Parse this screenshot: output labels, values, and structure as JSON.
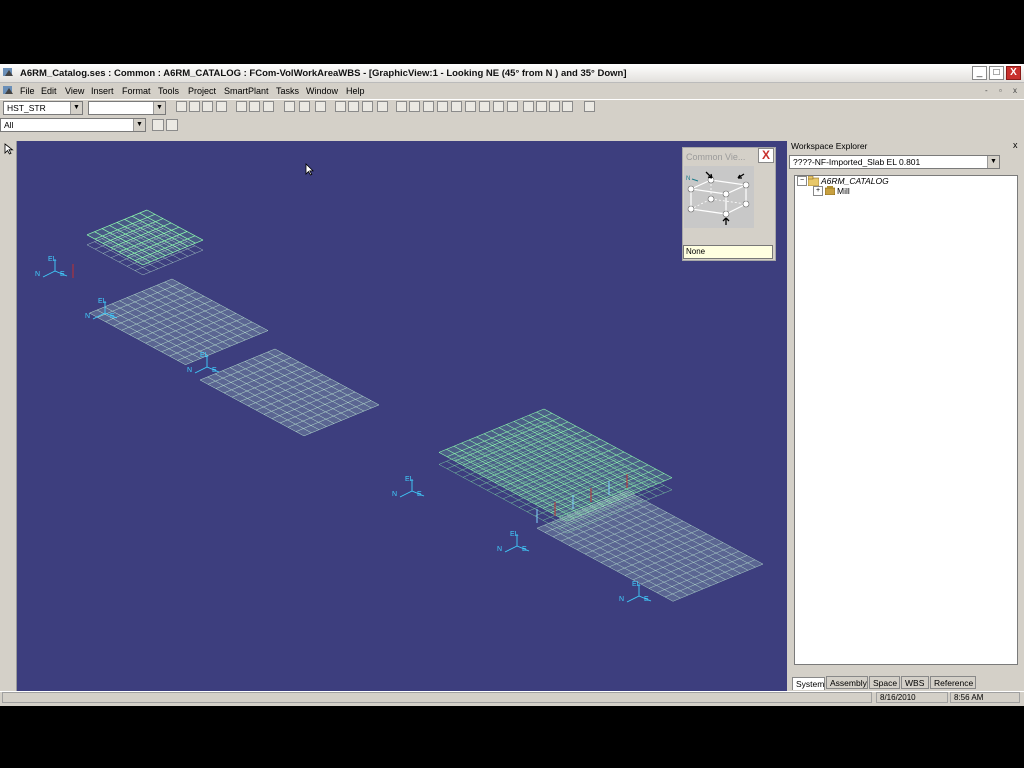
{
  "window": {
    "title": "A6RM_Catalog.ses : Common : A6RM_CATALOG : FCom-VolWorkAreaWBS - [GraphicView:1 - Looking NE (45° from N ) and 35° Down]",
    "min_label": "_",
    "max_label": "□",
    "close_label": "X",
    "mdi_min": "-",
    "mdi_restore": "▫",
    "mdi_close": "x"
  },
  "menu": [
    "File",
    "Edit",
    "View",
    "Insert",
    "Format",
    "Tools",
    "Project",
    "SmartPlant",
    "Tasks",
    "Window",
    "Help"
  ],
  "toolbar": {
    "permission_group": "HST_STR",
    "second_combo": "",
    "filter": "All",
    "combo_arrow": "▼"
  },
  "common_view": {
    "title": "Common Vie...",
    "close": "X",
    "value": "None",
    "north": "N"
  },
  "workspace": {
    "title": "Workspace Explorer",
    "close": "x",
    "combo_value": "????-NF-Imported_Slab EL 0.801",
    "tree": [
      {
        "label": "A6RM_CATALOG",
        "expander": "−"
      },
      {
        "label": "Mill",
        "expander": "+"
      }
    ],
    "tabs": [
      "System",
      "Assembly",
      "Space",
      "WBS",
      "Reference"
    ]
  },
  "status": {
    "date": "8/16/2010",
    "time": "8:56 AM"
  },
  "axis_labels": {
    "north": "N",
    "east": "E",
    "elevation": "EL"
  },
  "colors": {
    "viewport_bg": "#3d3e7e",
    "grid": "#90ffb0",
    "grid_dim": "#b8e0d0",
    "axis": "#40d0ff",
    "accent_red": "#c03030"
  }
}
